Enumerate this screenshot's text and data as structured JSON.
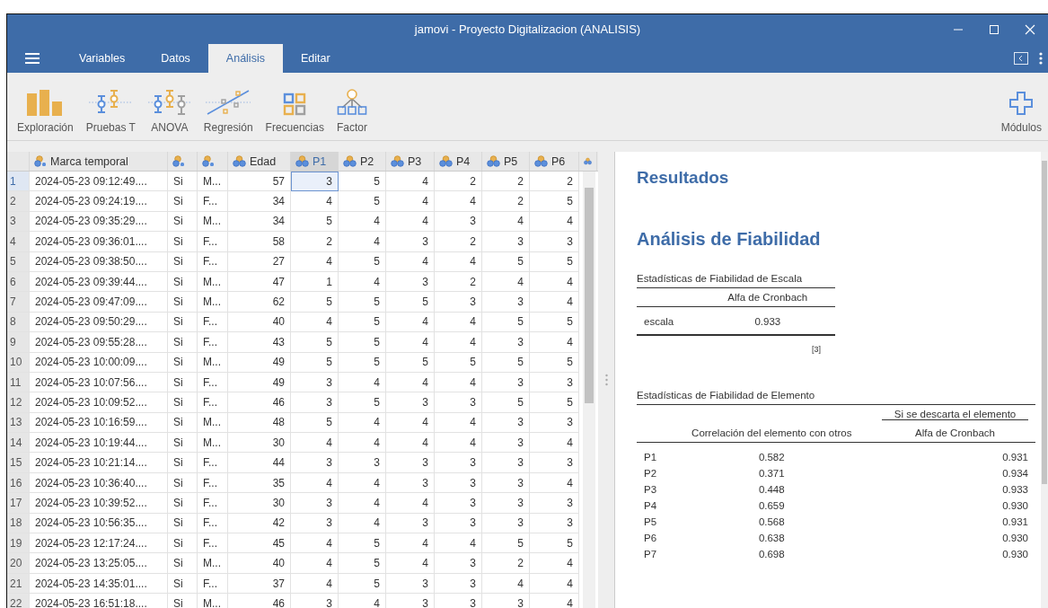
{
  "window": {
    "title": "jamovi - Proyecto Digitalizacion (ANALISIS)"
  },
  "tabs": [
    {
      "label": "Variables",
      "selected": false
    },
    {
      "label": "Datos",
      "selected": false
    },
    {
      "label": "Análisis",
      "selected": true
    },
    {
      "label": "Editar",
      "selected": false
    }
  ],
  "ribbon": {
    "items": [
      {
        "label": "Exploración",
        "kind": "exploration"
      },
      {
        "label": "Pruebas T",
        "kind": "ttest"
      },
      {
        "label": "ANOVA",
        "kind": "anova"
      },
      {
        "label": "Regresión",
        "kind": "regression"
      },
      {
        "label": "Frecuencias",
        "kind": "frequencies"
      },
      {
        "label": "Factor",
        "kind": "factor"
      }
    ],
    "modules": {
      "label": "Módulos"
    }
  },
  "table": {
    "columns": [
      {
        "name": "Marca temporal",
        "kind": "text",
        "selected": false
      },
      {
        "kind": "text",
        "selected": false
      },
      {
        "kind": "text",
        "selected": false
      },
      {
        "name": "Edad",
        "kind": "integer",
        "selected": false
      },
      {
        "name": "P1",
        "kind": "integer",
        "selected": true
      },
      {
        "name": "P2",
        "kind": "integer",
        "selected": false
      },
      {
        "name": "P3",
        "kind": "integer",
        "selected": false
      },
      {
        "name": "P4",
        "kind": "integer",
        "selected": false
      },
      {
        "name": "P5",
        "kind": "integer",
        "selected": false
      },
      {
        "name": "P6",
        "kind": "integer",
        "selected": false
      },
      {
        "kind": "integer",
        "selected": false
      }
    ],
    "rows": [
      {
        "n": "1",
        "selected": true,
        "cells": [
          "2024-05-23 09:12:49....",
          "Si",
          "M...",
          "57",
          "3",
          "5",
          "4",
          "2",
          "2",
          "2"
        ]
      },
      {
        "n": "2",
        "selected": false,
        "cells": [
          "2024-05-23 09:24:19....",
          "Si",
          "F...",
          "34",
          "4",
          "5",
          "4",
          "4",
          "2",
          "5"
        ]
      },
      {
        "n": "3",
        "selected": false,
        "cells": [
          "2024-05-23 09:35:29....",
          "Si",
          "M...",
          "34",
          "5",
          "4",
          "4",
          "3",
          "4",
          "4"
        ]
      },
      {
        "n": "4",
        "selected": false,
        "cells": [
          "2024-05-23 09:36:01....",
          "Si",
          "F...",
          "58",
          "2",
          "4",
          "3",
          "2",
          "3",
          "3"
        ]
      },
      {
        "n": "5",
        "selected": false,
        "cells": [
          "2024-05-23 09:38:50....",
          "Si",
          "F...",
          "27",
          "4",
          "5",
          "4",
          "4",
          "5",
          "5"
        ]
      },
      {
        "n": "6",
        "selected": false,
        "cells": [
          "2024-05-23 09:39:44....",
          "Si",
          "M...",
          "47",
          "1",
          "4",
          "3",
          "2",
          "4",
          "4"
        ]
      },
      {
        "n": "7",
        "selected": false,
        "cells": [
          "2024-05-23 09:47:09....",
          "Si",
          "M...",
          "62",
          "5",
          "5",
          "5",
          "3",
          "3",
          "4"
        ]
      },
      {
        "n": "8",
        "selected": false,
        "cells": [
          "2024-05-23 09:50:29....",
          "Si",
          "F...",
          "40",
          "4",
          "5",
          "4",
          "4",
          "5",
          "5"
        ]
      },
      {
        "n": "9",
        "selected": false,
        "cells": [
          "2024-05-23 09:55:28....",
          "Si",
          "F...",
          "43",
          "5",
          "5",
          "4",
          "4",
          "3",
          "4"
        ]
      },
      {
        "n": "10",
        "selected": false,
        "cells": [
          "2024-05-23 10:00:09....",
          "Si",
          "M...",
          "49",
          "5",
          "5",
          "5",
          "5",
          "5",
          "5"
        ]
      },
      {
        "n": "11",
        "selected": false,
        "cells": [
          "2024-05-23 10:07:56....",
          "Si",
          "F...",
          "49",
          "3",
          "4",
          "4",
          "4",
          "3",
          "3"
        ]
      },
      {
        "n": "12",
        "selected": false,
        "cells": [
          "2024-05-23 10:09:52....",
          "Si",
          "F...",
          "46",
          "3",
          "5",
          "3",
          "3",
          "5",
          "5"
        ]
      },
      {
        "n": "13",
        "selected": false,
        "cells": [
          "2024-05-23 10:16:59....",
          "Si",
          "M...",
          "48",
          "5",
          "4",
          "4",
          "4",
          "3",
          "3"
        ]
      },
      {
        "n": "14",
        "selected": false,
        "cells": [
          "2024-05-23 10:19:44....",
          "Si",
          "M...",
          "30",
          "4",
          "4",
          "4",
          "4",
          "3",
          "4"
        ]
      },
      {
        "n": "15",
        "selected": false,
        "cells": [
          "2024-05-23 10:21:14....",
          "Si",
          "F...",
          "44",
          "3",
          "3",
          "3",
          "3",
          "3",
          "3"
        ]
      },
      {
        "n": "16",
        "selected": false,
        "cells": [
          "2024-05-23 10:36:40....",
          "Si",
          "F...",
          "35",
          "4",
          "4",
          "3",
          "3",
          "3",
          "4"
        ]
      },
      {
        "n": "17",
        "selected": false,
        "cells": [
          "2024-05-23 10:39:52....",
          "Si",
          "F...",
          "30",
          "3",
          "4",
          "4",
          "3",
          "3",
          "3"
        ]
      },
      {
        "n": "18",
        "selected": false,
        "cells": [
          "2024-05-23 10:56:35....",
          "Si",
          "F...",
          "42",
          "3",
          "4",
          "3",
          "3",
          "3",
          "3"
        ]
      },
      {
        "n": "19",
        "selected": false,
        "cells": [
          "2024-05-23 12:17:24....",
          "Si",
          "F...",
          "45",
          "4",
          "5",
          "4",
          "4",
          "5",
          "5"
        ]
      },
      {
        "n": "20",
        "selected": false,
        "cells": [
          "2024-05-23 13:25:05....",
          "Si",
          "M...",
          "40",
          "4",
          "5",
          "4",
          "3",
          "2",
          "4"
        ]
      },
      {
        "n": "21",
        "selected": false,
        "cells": [
          "2024-05-23 14:35:01....",
          "Si",
          "F...",
          "37",
          "4",
          "5",
          "3",
          "3",
          "4",
          "4"
        ]
      },
      {
        "n": "22",
        "selected": false,
        "cells": [
          "2024-05-23 16:51:18....",
          "Si",
          "M...",
          "46",
          "3",
          "4",
          "3",
          "3",
          "3",
          "4"
        ]
      }
    ]
  },
  "results": {
    "heading": "Resultados",
    "analysis_title": "Análisis de Fiabilidad",
    "scale_table": {
      "title": "Estadísticas de Fiabilidad de Escala",
      "columns": [
        "",
        "Alfa de Cronbach"
      ],
      "rows": [
        [
          "escala",
          "0.933"
        ]
      ],
      "footnote": "[3]"
    },
    "item_table": {
      "title": "Estadísticas de Fiabilidad de Elemento",
      "span_header": "Si se descarta el elemento",
      "columns": [
        "",
        "Correlación del elemento con otros",
        "Alfa de Cronbach"
      ],
      "rows": [
        [
          "P1",
          "0.582",
          "0.931"
        ],
        [
          "P2",
          "0.371",
          "0.934"
        ],
        [
          "P3",
          "0.448",
          "0.933"
        ],
        [
          "P4",
          "0.659",
          "0.930"
        ],
        [
          "P5",
          "0.568",
          "0.931"
        ],
        [
          "P6",
          "0.638",
          "0.930"
        ],
        [
          "P7",
          "0.698",
          "0.930"
        ]
      ]
    }
  }
}
